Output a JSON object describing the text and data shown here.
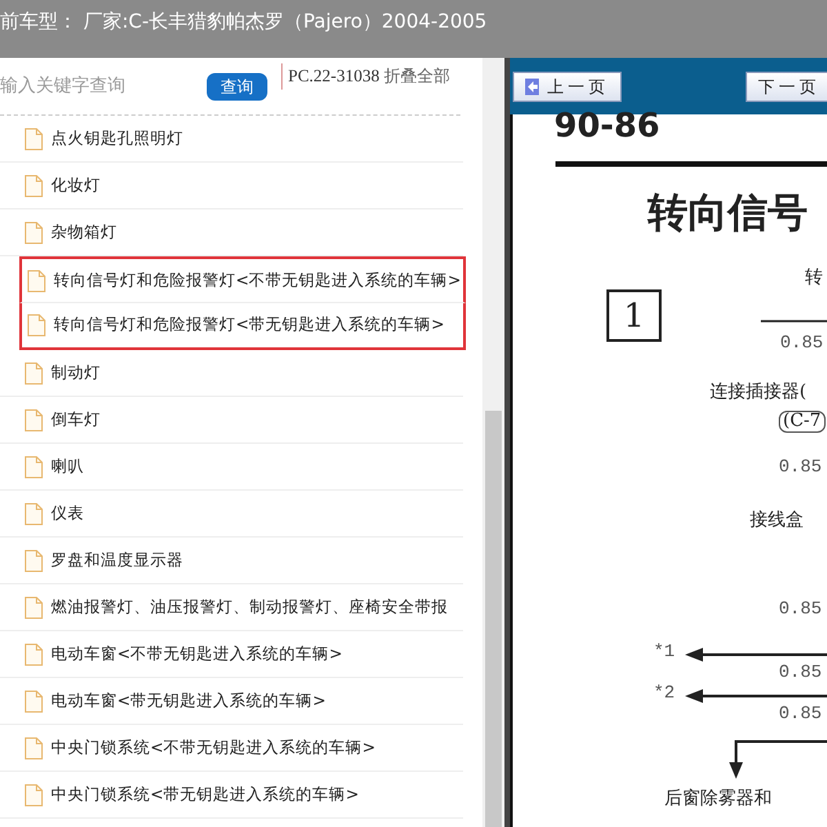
{
  "header": {
    "title": "前车型： 厂家:C-长丰猎豹帕杰罗（Pajero）2004-2005"
  },
  "search": {
    "placeholder": "输入关键字查询",
    "button": "查询"
  },
  "code": "PC.22-31038",
  "collapse_all": "折叠全部",
  "items": [
    {
      "label": "点火钥匙孔照明灯",
      "highlighted": false
    },
    {
      "label": "化妆灯",
      "highlighted": false
    },
    {
      "label": "杂物箱灯",
      "highlighted": false
    },
    {
      "label": "转向信号灯和危险报警灯<不带无钥匙进入系统的车辆>",
      "highlighted": true
    },
    {
      "label": "转向信号灯和危险报警灯<带无钥匙进入系统的车辆>",
      "highlighted": true
    },
    {
      "label": "制动灯",
      "highlighted": false
    },
    {
      "label": "倒车灯",
      "highlighted": false
    },
    {
      "label": "喇叭",
      "highlighted": false
    },
    {
      "label": "仪表",
      "highlighted": false
    },
    {
      "label": "罗盘和温度显示器",
      "highlighted": false
    },
    {
      "label": "燃油报警灯、油压报警灯、制动报警灯、座椅安全带报",
      "highlighted": false
    },
    {
      "label": "电动车窗<不带无钥匙进入系统的车辆>",
      "highlighted": false
    },
    {
      "label": "电动车窗<带无钥匙进入系统的车辆>",
      "highlighted": false
    },
    {
      "label": "中央门锁系统<不带无钥匙进入系统的车辆>",
      "highlighted": false
    },
    {
      "label": "中央门锁系统<带无钥匙进入系统的车辆>",
      "highlighted": false
    }
  ],
  "viewer": {
    "prev_button": "上一页",
    "next_button": "下一页",
    "page": {
      "page_number": "90-86",
      "title": "转向信号",
      "box_label": "1",
      "labels": [
        {
          "kind": "text",
          "text": "转"
        },
        {
          "kind": "wire",
          "text": "0.85"
        },
        {
          "kind": "text",
          "text": "连接插接器("
        },
        {
          "kind": "connector",
          "text": "(C-7"
        },
        {
          "kind": "wire",
          "text": "0.85"
        },
        {
          "kind": "text",
          "text": "接线盒"
        },
        {
          "kind": "wire",
          "text": "0.85"
        },
        {
          "kind": "note",
          "text": "*1"
        },
        {
          "kind": "wire",
          "text": "0.85"
        },
        {
          "kind": "note",
          "text": "*2"
        },
        {
          "kind": "wire",
          "text": "0.85"
        },
        {
          "kind": "text",
          "text": "后窗除雾器和"
        }
      ]
    }
  }
}
